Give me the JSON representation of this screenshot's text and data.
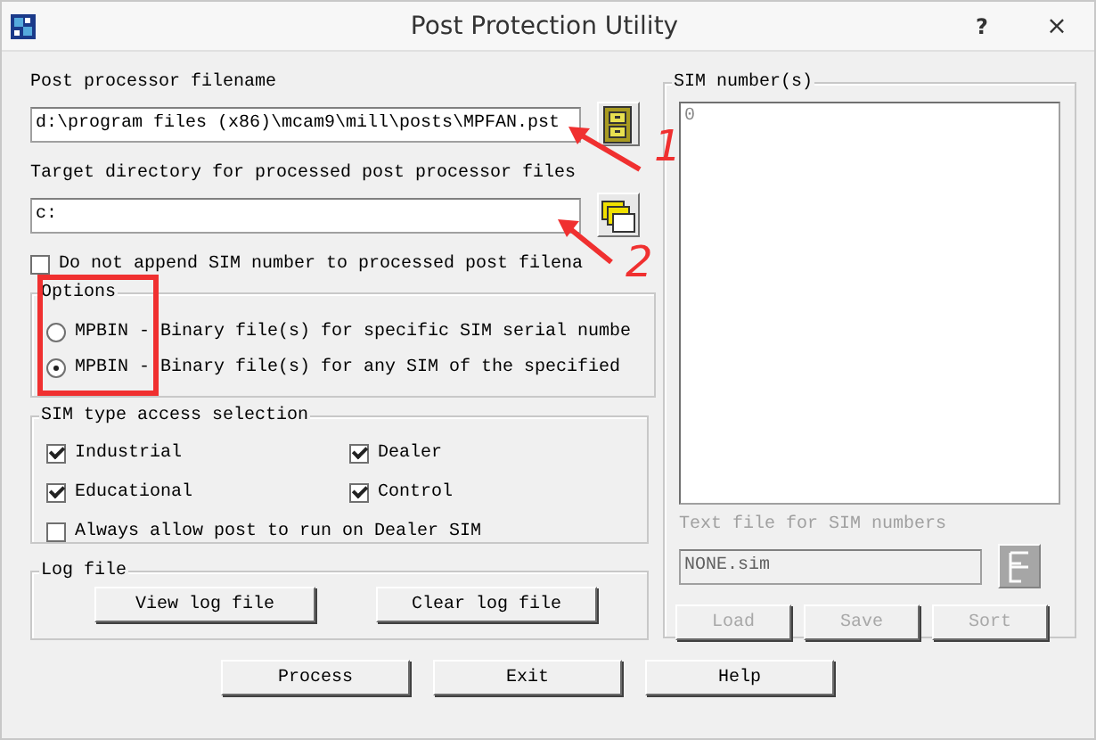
{
  "window": {
    "title": "Post Protection Utility",
    "help": "?",
    "close": "×"
  },
  "post_file": {
    "label": "Post processor filename",
    "value": "d:\\program files (x86)\\mcam9\\mill\\posts\\MPFAN.pst"
  },
  "target_dir": {
    "label": "Target directory for processed post processor files",
    "value": "c:"
  },
  "append_option": {
    "label": "Do not append SIM number to processed post filena",
    "checked": false
  },
  "options": {
    "title": "Options",
    "radios": [
      {
        "label": "MPBIN - Binary file(s) for specific SIM serial numbe",
        "selected": false
      },
      {
        "label": "MPBIN - Binary file(s) for any SIM of the specified",
        "selected": true
      }
    ]
  },
  "sim_type": {
    "title": "SIM type access selection",
    "checks": [
      {
        "label": "Industrial",
        "checked": true
      },
      {
        "label": "Dealer",
        "checked": true
      },
      {
        "label": "Educational",
        "checked": true
      },
      {
        "label": "Control",
        "checked": true
      },
      {
        "label": "Always allow post to run on Dealer SIM",
        "checked": false
      }
    ]
  },
  "log_file": {
    "title": "Log file",
    "buttons": [
      "View log file",
      "Clear log file"
    ]
  },
  "actions": [
    "Process",
    "Exit",
    "Help"
  ],
  "sim_panel": {
    "title": "SIM number(s)",
    "numbers": [
      "0"
    ],
    "text_file": {
      "label": "Text file for SIM numbers",
      "value": "NONE.sim",
      "disabled": true
    },
    "buttons": [
      {
        "label": "Load",
        "disabled": true
      },
      {
        "label": "Save",
        "disabled": true
      },
      {
        "label": "Sort",
        "disabled": true
      }
    ]
  },
  "annotations": [
    {
      "kind": "arrow"
    },
    {
      "kind": "number",
      "text": "1"
    },
    {
      "kind": "arrow"
    },
    {
      "kind": "number",
      "text": "2"
    },
    {
      "kind": "box"
    }
  ]
}
